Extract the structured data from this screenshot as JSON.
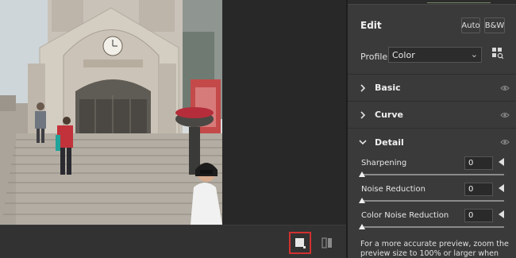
{
  "edit": {
    "title": "Edit",
    "auto_label": "Auto",
    "bw_label": "B&W"
  },
  "profile": {
    "label": "Profile",
    "value": "Color"
  },
  "sections": [
    {
      "label": "Basic",
      "expanded": false
    },
    {
      "label": "Curve",
      "expanded": false
    },
    {
      "label": "Detail",
      "expanded": true
    }
  ],
  "detail": {
    "sliders": [
      {
        "label": "Sharpening",
        "value": "0"
      },
      {
        "label": "Noise Reduction",
        "value": "0"
      },
      {
        "label": "Color Noise Reduction",
        "value": "0"
      }
    ],
    "note": "For a more accurate preview, zoom the preview size to 100% or larger when adjusting the"
  },
  "icons": {
    "expand": "chevron-right-icon",
    "collapse": "chevron-down-icon",
    "visibility": "eye-icon",
    "profile_browser": "grid-browse-icon",
    "single_view": "single-view-icon",
    "compare_view": "before-after-icon"
  },
  "colors": {
    "panel_bg": "#3a3a3a",
    "workspace_bg": "#282828",
    "selected_outline": "#d23030"
  }
}
